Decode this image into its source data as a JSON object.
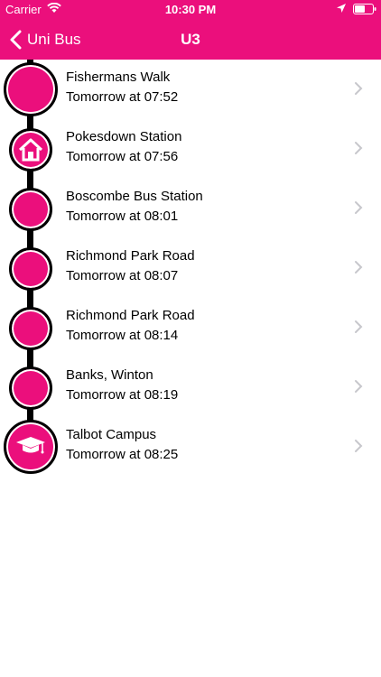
{
  "status_bar": {
    "carrier": "Carrier",
    "time": "10:30 PM"
  },
  "nav": {
    "back_label": "Uni Bus",
    "title": "U3"
  },
  "colors": {
    "accent": "#eb0f7c",
    "track": "#000000",
    "chevron": "#c7c7cc"
  },
  "stops": [
    {
      "name": "Fishermans Walk",
      "time": "Tomorrow at 07:52",
      "icon": "stop-circle-icon"
    },
    {
      "name": "Pokesdown Station",
      "time": "Tomorrow at 07:56",
      "icon": "home-icon"
    },
    {
      "name": "Boscombe Bus Station",
      "time": "Tomorrow at 08:01",
      "icon": "stop-circle-icon"
    },
    {
      "name": "Richmond Park Road",
      "time": "Tomorrow at 08:07",
      "icon": "stop-circle-icon"
    },
    {
      "name": "Richmond Park Road",
      "time": "Tomorrow at 08:14",
      "icon": "stop-circle-icon"
    },
    {
      "name": "Banks, Winton",
      "time": "Tomorrow at 08:19",
      "icon": "stop-circle-icon"
    },
    {
      "name": "Talbot Campus",
      "time": "Tomorrow at 08:25",
      "icon": "graduation-cap-icon"
    }
  ]
}
